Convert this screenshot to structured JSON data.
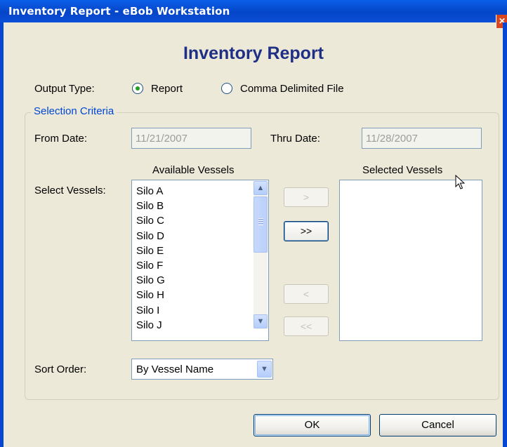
{
  "window": {
    "title": "Inventory Report - eBob Workstation",
    "close_symbol": "✕"
  },
  "heading": "Inventory Report",
  "output_type": {
    "label": "Output Type:",
    "options": [
      "Report",
      "Comma Delimited File"
    ],
    "selected": "Report"
  },
  "selection_criteria": {
    "legend": "Selection Criteria",
    "from_date_label": "From Date:",
    "from_date_value": "11/21/2007",
    "thru_date_label": "Thru Date:",
    "thru_date_value": "11/28/2007",
    "select_vessels_label": "Select Vessels:",
    "available_header": "Available Vessels",
    "selected_header": "Selected Vessels",
    "available_vessels": [
      "Silo A",
      "Silo B",
      "Silo C",
      "Silo D",
      "Silo E",
      "Silo F",
      "Silo G",
      "Silo H",
      "Silo I",
      "Silo J"
    ],
    "selected_vessels": [],
    "move_buttons": {
      "add_one": ">",
      "add_all": ">>",
      "remove_one": "<",
      "remove_all": "<<"
    },
    "sort_order_label": "Sort Order:",
    "sort_order_value": "By Vessel Name"
  },
  "buttons": {
    "ok": "OK",
    "cancel": "Cancel"
  },
  "icons": {
    "close": "close-icon",
    "scroll_up": "scroll-up-arrow-icon",
    "scroll_down": "scroll-down-arrow-icon",
    "dropdown": "chevron-down-icon",
    "cursor": "mouse-pointer-icon"
  },
  "colors": {
    "title_bar": "#0A5FE8",
    "heading": "#1F2F85",
    "legend": "#0046D5",
    "window_bg": "#ECE9D8",
    "radio_dot": "#21A121"
  }
}
